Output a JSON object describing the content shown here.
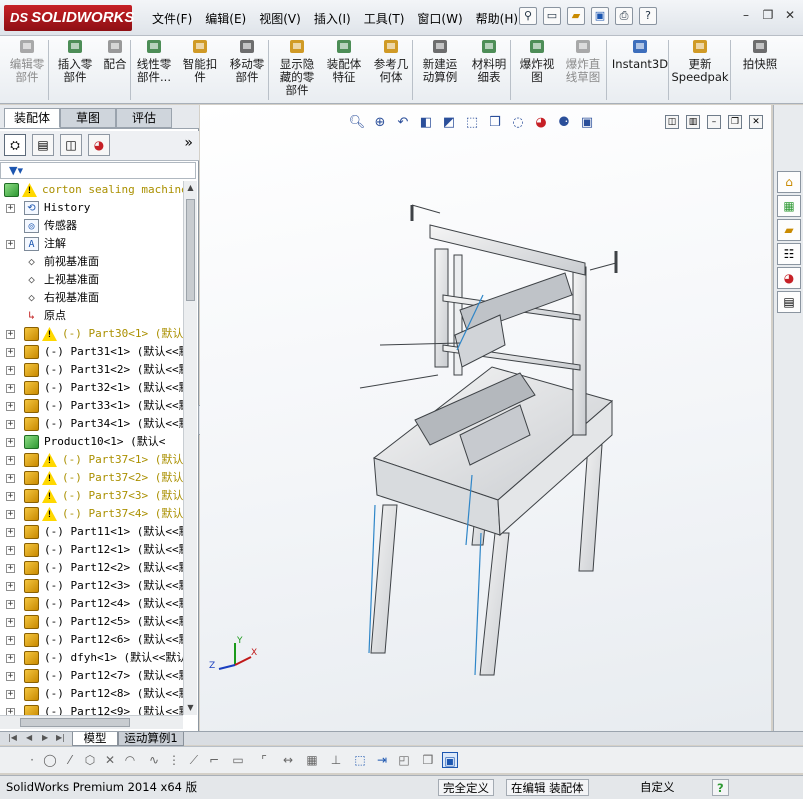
{
  "app": {
    "logo_ds": "DS",
    "logo_text": "SOLIDWORKS"
  },
  "menu": [
    "文件(F)",
    "编辑(E)",
    "视图(V)",
    "插入(I)",
    "工具(T)",
    "窗口(W)",
    "帮助(H)"
  ],
  "command_manager": {
    "items": [
      {
        "label1": "编辑零",
        "label2": "部件",
        "icon": "edit-component-icon",
        "disabled": true
      },
      {
        "label1": "插入零",
        "label2": "部件",
        "icon": "insert-component-icon",
        "disabled": false
      },
      {
        "label1": "配合",
        "label2": "",
        "icon": "mate-icon",
        "disabled": false
      },
      {
        "label1": "线性零",
        "label2": "部件...",
        "icon": "linear-pattern-icon",
        "disabled": false
      },
      {
        "label1": "智能扣",
        "label2": "件",
        "icon": "smart-fasteners-icon",
        "disabled": false
      },
      {
        "label1": "移动零",
        "label2": "部件",
        "icon": "move-component-icon",
        "disabled": false
      },
      {
        "label1": "显示隐",
        "label2": "藏的零",
        "label3": "部件",
        "icon": "show-hidden-icon",
        "disabled": false
      },
      {
        "label1": "装配体",
        "label2": "特征",
        "icon": "assembly-features-icon",
        "disabled": false
      },
      {
        "label1": "参考几",
        "label2": "何体",
        "icon": "reference-geometry-icon",
        "disabled": false
      },
      {
        "label1": "新建运",
        "label2": "动算例",
        "icon": "new-motion-study-icon",
        "disabled": false
      },
      {
        "label1": "材料明",
        "label2": "细表",
        "icon": "bom-icon",
        "disabled": false
      },
      {
        "label1": "爆炸视",
        "label2": "图",
        "icon": "exploded-view-icon",
        "disabled": false
      },
      {
        "label1": "爆炸直",
        "label2": "线草图",
        "icon": "explode-line-sketch-icon",
        "disabled": true
      },
      {
        "label1": "Instant3D",
        "label2": "",
        "icon": "instant3d-icon",
        "disabled": false
      },
      {
        "label1": "更新",
        "label2": "Speedpak",
        "icon": "speedpak-icon",
        "disabled": false
      },
      {
        "label1": "拍快照",
        "label2": "",
        "icon": "snapshot-icon",
        "disabled": false
      }
    ]
  },
  "left_tabs": [
    "装配体",
    "草图",
    "评估"
  ],
  "feature_tree": {
    "rows": [
      {
        "text": "corton sealing machine",
        "icon": "assembly",
        "warn": true,
        "pm": "",
        "root": true
      },
      {
        "text": "History",
        "icon": "history",
        "warn": false,
        "pm": "+"
      },
      {
        "text": "传感器",
        "icon": "sensor",
        "warn": false,
        "pm": ""
      },
      {
        "text": "注解",
        "icon": "annotation",
        "warn": false,
        "pm": "+"
      },
      {
        "text": "前视基准面",
        "icon": "plane",
        "warn": false,
        "pm": ""
      },
      {
        "text": "上视基准面",
        "icon": "plane",
        "warn": false,
        "pm": ""
      },
      {
        "text": "右视基准面",
        "icon": "plane",
        "warn": false,
        "pm": ""
      },
      {
        "text": "原点",
        "icon": "origin",
        "warn": false,
        "pm": ""
      },
      {
        "text": "(-) Part30<1> (默认<",
        "icon": "part",
        "warn": true,
        "pm": "+"
      },
      {
        "text": "(-) Part31<1> (默认<<默",
        "icon": "part",
        "warn": false,
        "pm": "+"
      },
      {
        "text": "(-) Part31<2> (默认<<默",
        "icon": "part",
        "warn": false,
        "pm": "+"
      },
      {
        "text": "(-) Part32<1> (默认<<默",
        "icon": "part",
        "warn": false,
        "pm": "+"
      },
      {
        "text": "(-) Part33<1> (默认<<默",
        "icon": "part",
        "warn": false,
        "pm": "+"
      },
      {
        "text": "(-) Part34<1> (默认<<默",
        "icon": "part",
        "warn": false,
        "pm": "+"
      },
      {
        "text": "Product10<1> (默认<",
        "icon": "partg",
        "warn": false,
        "pm": "+"
      },
      {
        "text": "(-) Part37<1> (默认<",
        "icon": "part",
        "warn": true,
        "pm": "+"
      },
      {
        "text": "(-) Part37<2> (默认<",
        "icon": "part",
        "warn": true,
        "pm": "+"
      },
      {
        "text": "(-) Part37<3> (默认<",
        "icon": "part",
        "warn": true,
        "pm": "+"
      },
      {
        "text": "(-) Part37<4> (默认<",
        "icon": "part",
        "warn": true,
        "pm": "+"
      },
      {
        "text": "(-) Part11<1> (默认<<默",
        "icon": "part",
        "warn": false,
        "pm": "+"
      },
      {
        "text": "(-) Part12<1> (默认<<默",
        "icon": "part",
        "warn": false,
        "pm": "+"
      },
      {
        "text": "(-) Part12<2> (默认<<默",
        "icon": "part",
        "warn": false,
        "pm": "+"
      },
      {
        "text": "(-) Part12<3> (默认<<默",
        "icon": "part",
        "warn": false,
        "pm": "+"
      },
      {
        "text": "(-) Part12<4> (默认<<默",
        "icon": "part",
        "warn": false,
        "pm": "+"
      },
      {
        "text": "(-) Part12<5> (默认<<默",
        "icon": "part",
        "warn": false,
        "pm": "+"
      },
      {
        "text": "(-) Part12<6> (默认<<默",
        "icon": "part",
        "warn": false,
        "pm": "+"
      },
      {
        "text": "(-) dfyh<1> (默认<<默认",
        "icon": "part",
        "warn": false,
        "pm": "+"
      },
      {
        "text": "(-) Part12<7> (默认<<默",
        "icon": "part",
        "warn": false,
        "pm": "+"
      },
      {
        "text": "(-) Part12<8> (默认<<默",
        "icon": "part",
        "warn": false,
        "pm": "+"
      },
      {
        "text": "(-) Part12<9> (默认<<默",
        "icon": "part",
        "warn": false,
        "pm": "+"
      }
    ]
  },
  "bottom_tabs": [
    "模型",
    "运动算例1"
  ],
  "statusbar": {
    "app_version": "SolidWorks Premium 2014 x64 版",
    "definition": "完全定义",
    "mode": "在编辑 装配体",
    "units": "自定义",
    "help": "?"
  },
  "triad": {
    "x": "X",
    "y": "Y",
    "z": "Z"
  },
  "colors": {
    "accent": "#c62026",
    "warning": "#ffd800",
    "part": "#f4c640"
  }
}
